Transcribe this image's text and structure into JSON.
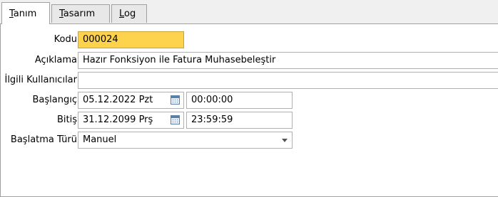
{
  "tabs": [
    {
      "prefix": "",
      "underlined": "T",
      "rest": "anım"
    },
    {
      "prefix": "",
      "underlined": "T",
      "rest": "asarım"
    },
    {
      "prefix": "",
      "underlined": "L",
      "rest": "og"
    }
  ],
  "form": {
    "kodu_label": "Kodu",
    "kodu_value": "000024",
    "aciklama_label": "Açıklama",
    "aciklama_value": "Hazır Fonksiyon ile Fatura Muhasebeleştir",
    "ilgili_label": "İlgili Kullanıcılar",
    "ilgili_value": "",
    "baslangic_label": "Başlangıç",
    "baslangic_date": "05.12.2022 Pzt",
    "baslangic_time": "00:00:00",
    "bitis_label": "Bitiş",
    "bitis_date": "31.12.2099 Prş",
    "bitis_time": "23:59:59",
    "baslatma_label": "Başlatma Türü",
    "baslatma_value": "Manuel"
  },
  "icons": {
    "calendar": "calendar-icon",
    "dropdown": "chevron-down-icon"
  }
}
